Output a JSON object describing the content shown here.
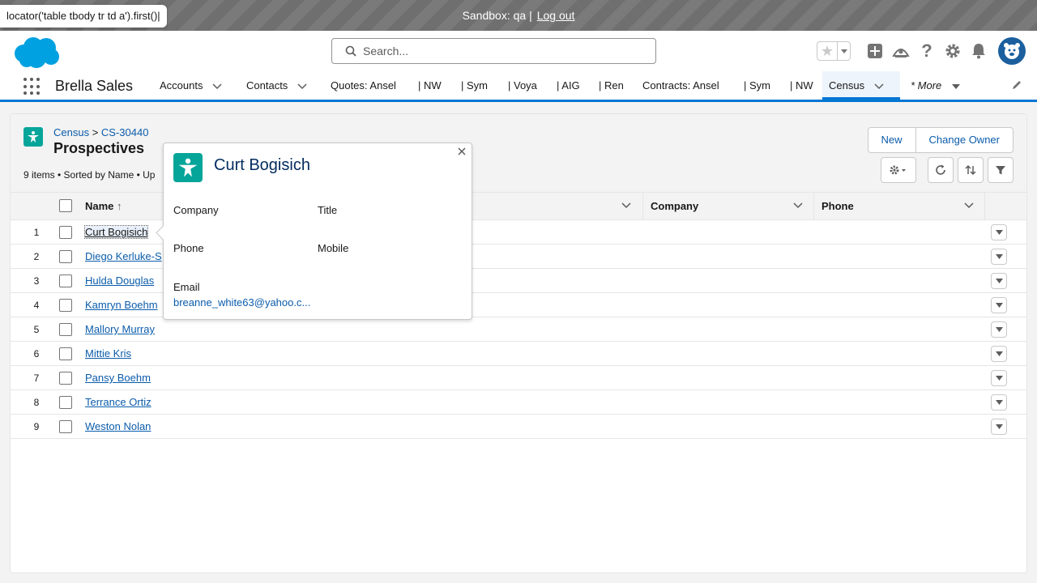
{
  "locator_tip": "locator('table tbody tr td a').first()|",
  "sandbox": {
    "text": "Sandbox: qa |",
    "logout": "Log out"
  },
  "search": {
    "placeholder": "Search..."
  },
  "app_name": "Brella Sales",
  "nav": [
    {
      "label": "Accounts",
      "chevron": true
    },
    {
      "label": "Contacts",
      "chevron": true
    },
    {
      "label": "Quotes: Ansel",
      "chevron": false
    },
    {
      "label": "| NW",
      "chevron": false
    },
    {
      "label": "| Sym",
      "chevron": false
    },
    {
      "label": "| Voya",
      "chevron": false
    },
    {
      "label": "| AIG",
      "chevron": false
    },
    {
      "label": "| Ren",
      "chevron": false
    },
    {
      "label": "Contracts: Ansel",
      "chevron": false
    },
    {
      "label": "| Sym",
      "chevron": false
    },
    {
      "label": "| NW",
      "chevron": false
    },
    {
      "label": "Census",
      "chevron": true,
      "active": true
    },
    {
      "label": "* More",
      "chevron": true
    }
  ],
  "list": {
    "breadcrumb_obj": "Census",
    "breadcrumb_sep": ">",
    "breadcrumb_record": "CS-30440",
    "title": "Prospectives",
    "meta": "9 items • Sorted by Name • Up",
    "new_label": "New",
    "change_owner_label": "Change Owner",
    "columns": {
      "name": "Name",
      "name_sort": "↑",
      "company": "Company",
      "phone": "Phone"
    },
    "rows": [
      {
        "num": "1",
        "name": "Curt Bogisich"
      },
      {
        "num": "2",
        "name": "Diego Kerluke-S"
      },
      {
        "num": "3",
        "name": "Hulda Douglas"
      },
      {
        "num": "4",
        "name": "Kamryn Boehm"
      },
      {
        "num": "5",
        "name": "Mallory Murray"
      },
      {
        "num": "6",
        "name": "Mittie Kris"
      },
      {
        "num": "7",
        "name": "Pansy Boehm"
      },
      {
        "num": "8",
        "name": "Terrance Ortiz"
      },
      {
        "num": "9",
        "name": "Weston Nolan"
      }
    ]
  },
  "popover": {
    "title": "Curt Bogisich",
    "company_label": "Company",
    "title_label": "Title",
    "phone_label": "Phone",
    "mobile_label": "Mobile",
    "email_label": "Email",
    "email_value": "breanne_white63@yahoo.c..."
  },
  "colors": {
    "brand": "#0176d3",
    "link": "#0b5cab",
    "census_icon": "#06a59a"
  }
}
